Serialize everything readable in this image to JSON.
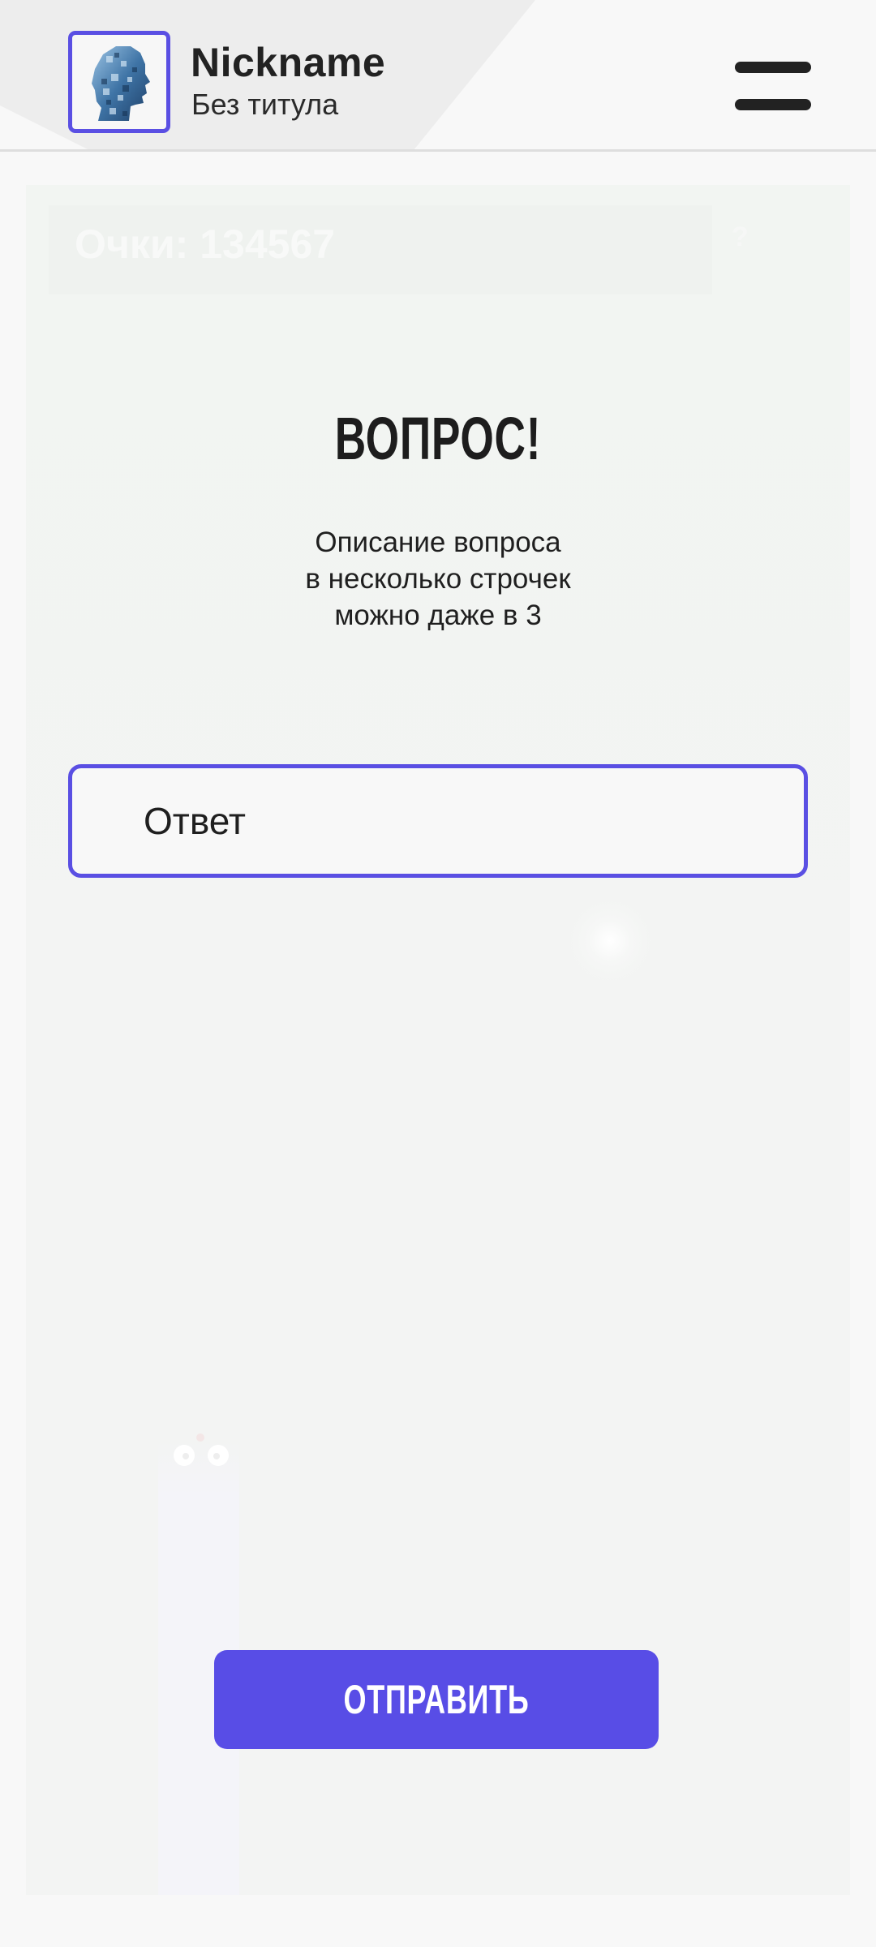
{
  "header": {
    "nickname": "Nickname",
    "user_title": "Без титула",
    "avatar_icon": "user-avatar-icon",
    "menu_icon": "hamburger-menu-icon"
  },
  "score": {
    "label": "Очки: 134567",
    "side_text": "?"
  },
  "question": {
    "title": "ВОПРОС!",
    "description": "Описание вопроса\nв несколько строчек\nможно даже в 3"
  },
  "answer": {
    "placeholder": "Ответ",
    "value": ""
  },
  "submit": {
    "label": "ОТПРАВИТЬ"
  },
  "colors": {
    "accent": "#584de6",
    "background": "#f8f8f8",
    "text": "#1f1f1f"
  }
}
